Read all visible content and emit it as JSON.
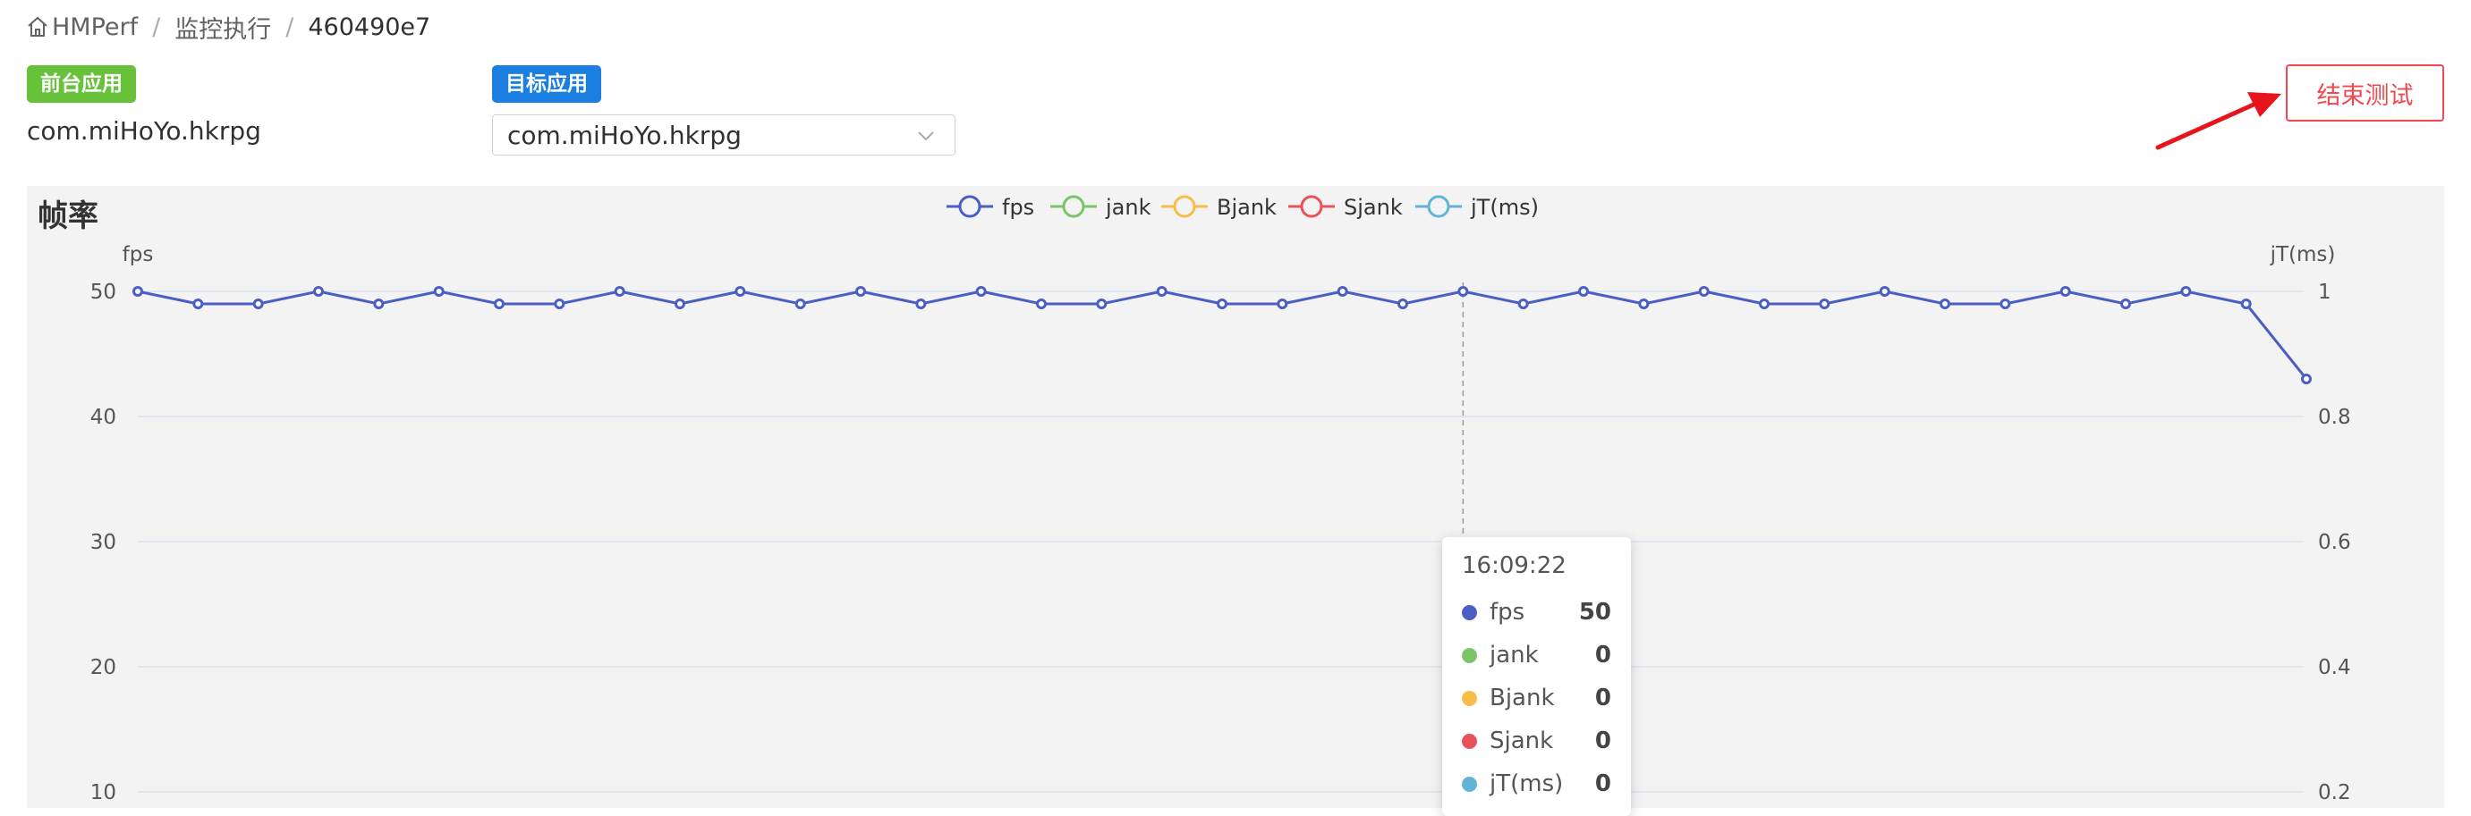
{
  "breadcrumb": {
    "home": "HMPerf",
    "section": "监控执行",
    "current": "460490e7",
    "separator": "/"
  },
  "foreground_app": {
    "tag": "前台应用",
    "value": "com.miHoYo.hkrpg"
  },
  "target_app": {
    "tag": "目标应用",
    "selected": "com.miHoYo.hkrpg"
  },
  "end_test_button": "结束测试",
  "panel_title": "帧率",
  "tooltip": {
    "time": "16:09:22",
    "rows": [
      {
        "name": "fps",
        "value": "50",
        "color": "#4a5ec4"
      },
      {
        "name": "jank",
        "value": "0",
        "color": "#7cc46a"
      },
      {
        "name": "Bjank",
        "value": "0",
        "color": "#f7bd4b"
      },
      {
        "name": "Sjank",
        "value": "0",
        "color": "#e8535a"
      },
      {
        "name": "jT(ms)",
        "value": "0",
        "color": "#63b3d9"
      }
    ]
  },
  "chart_data": {
    "type": "line",
    "left_axis": {
      "label": "fps",
      "ticks": [
        50,
        40,
        30,
        20,
        10
      ],
      "ylim": [
        0,
        50
      ]
    },
    "right_axis": {
      "label": "jT(ms)",
      "ticks": [
        "1",
        "0.8",
        "0.6",
        "0.4",
        "0.2"
      ],
      "ylim": [
        0,
        1
      ]
    },
    "grid": true,
    "legend_position": "top-center",
    "cursor_index": 22,
    "series": [
      {
        "name": "fps",
        "color": "#4a5ec4",
        "axis": "left",
        "values": [
          50,
          49,
          49,
          50,
          49,
          50,
          49,
          49,
          50,
          49,
          50,
          49,
          50,
          49,
          50,
          49,
          49,
          50,
          49,
          49,
          50,
          49,
          50,
          49,
          50,
          49,
          50,
          49,
          49,
          50,
          49,
          49,
          50,
          49,
          50,
          49,
          43
        ]
      },
      {
        "name": "jank",
        "color": "#7cc46a",
        "axis": "left",
        "values": []
      },
      {
        "name": "Bjank",
        "color": "#f7bd4b",
        "axis": "left",
        "values": []
      },
      {
        "name": "Sjank",
        "color": "#e8535a",
        "axis": "left",
        "values": []
      },
      {
        "name": "jT(ms)",
        "color": "#63b3d9",
        "axis": "right",
        "values": []
      }
    ]
  }
}
